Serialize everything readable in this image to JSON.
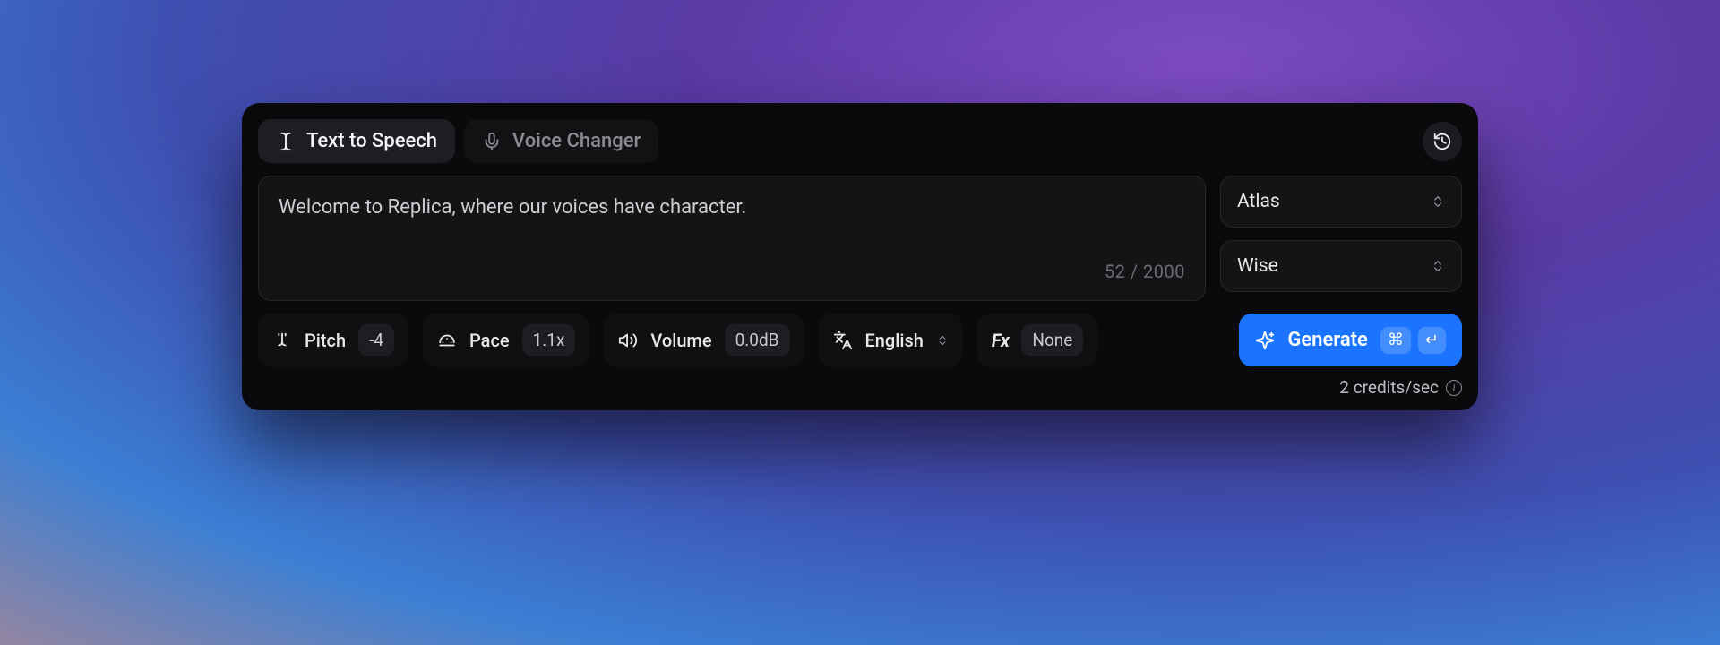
{
  "tabs": {
    "tts": "Text to Speech",
    "vc": "Voice Changer"
  },
  "input": {
    "text": "Welcome to Replica, where our voices have character.",
    "count": "52 / 2000"
  },
  "voice_select": {
    "value": "Atlas"
  },
  "style_select": {
    "value": "Wise"
  },
  "params": {
    "pitch": {
      "label": "Pitch",
      "value": "-4"
    },
    "pace": {
      "label": "Pace",
      "value": "1.1x"
    },
    "volume": {
      "label": "Volume",
      "value": "0.0dB"
    },
    "language": {
      "label": "English"
    },
    "fx": {
      "label": "Fx",
      "value": "None"
    }
  },
  "generate": {
    "label": "Generate",
    "shortcut_mod": "⌘",
    "shortcut_key": "↵"
  },
  "credits": "2 credits/sec"
}
